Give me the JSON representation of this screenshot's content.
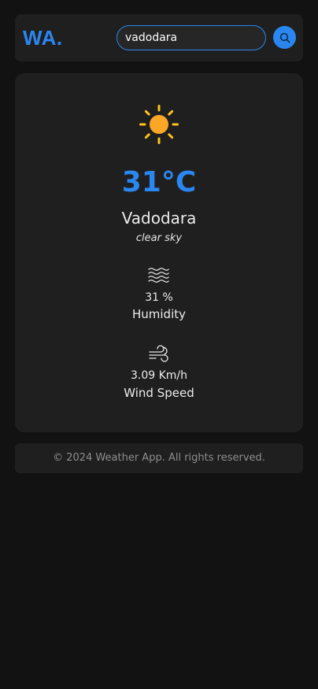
{
  "header": {
    "logo": "WA.",
    "search": {
      "value": "vadodara",
      "placeholder": "",
      "button_icon": "search-icon"
    }
  },
  "weather": {
    "icon": "sun-icon",
    "temperature": "31°C",
    "city": "Vadodara",
    "description": "clear sky",
    "humidity": {
      "icon": "waves-icon",
      "value": "31 %",
      "label": "Humidity"
    },
    "wind": {
      "icon": "wind-icon",
      "value": "3.09 Km/h",
      "label": "Wind Speed"
    }
  },
  "footer": {
    "text": "© 2024 Weather App. All rights reserved."
  },
  "colors": {
    "accent": "#2a87f0",
    "background": "#121212",
    "card": "#1f1f1f",
    "sun_body": "#fba627",
    "sun_rays": "#ffc21a",
    "footer_text": "#8e8e8e"
  }
}
